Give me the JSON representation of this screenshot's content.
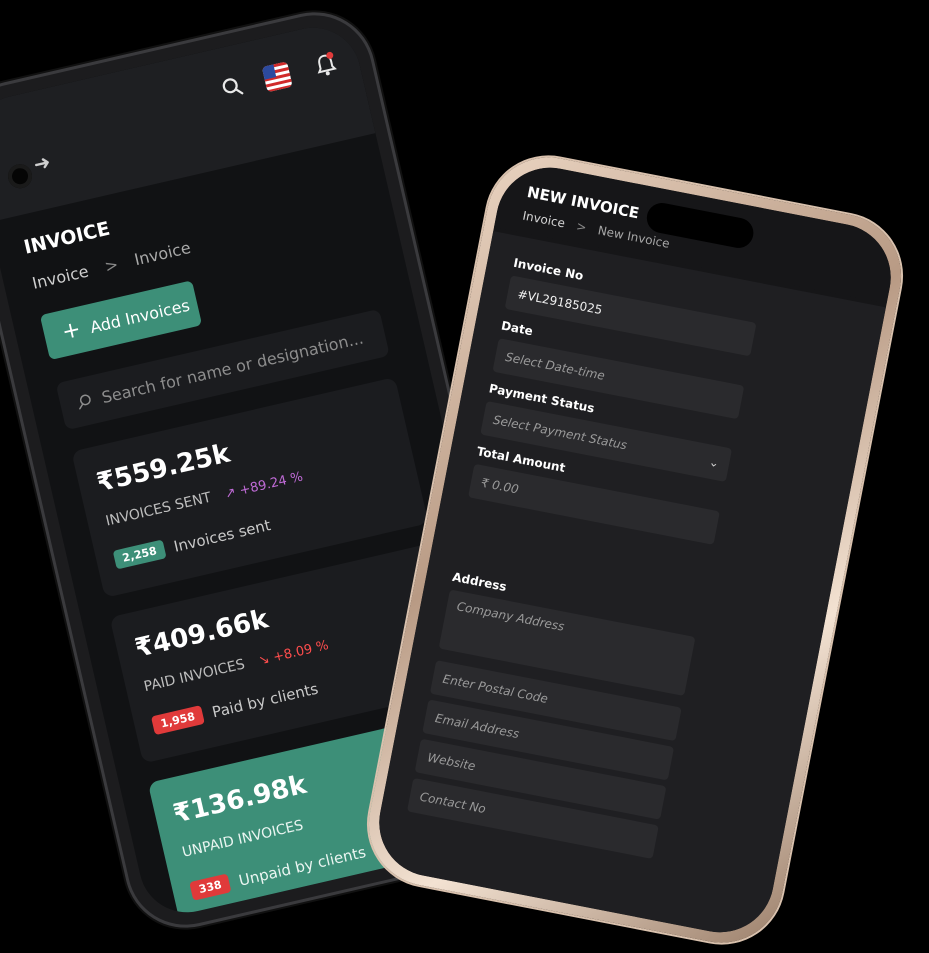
{
  "left_phone": {
    "title": "INVOICE",
    "breadcrumb": {
      "root": "Invoice",
      "separator": ">",
      "current": "Invoice"
    },
    "add_button": {
      "icon": "plus-icon",
      "label": "Add Invoices"
    },
    "search": {
      "placeholder": "Search for name or designation..."
    },
    "stats": [
      {
        "amount": "₹559.25k",
        "label": "INVOICES SENT",
        "change": "↗ +89.24 %",
        "trend": "up",
        "badge": "2,258",
        "badge_color": "#3d8f78",
        "footer": "Invoices sent"
      },
      {
        "amount": "₹409.66k",
        "label": "PAID INVOICES",
        "change": "↘ +8.09 %",
        "trend": "down",
        "badge": "1,958",
        "badge_color": "#e03a3a",
        "footer": "Paid by clients"
      },
      {
        "amount": "₹136.98k",
        "label": "UNPAID INVOICES",
        "badge": "338",
        "badge_color": "#e03a3a",
        "footer": "Unpaid by clients"
      }
    ],
    "accent": "#3d8f78"
  },
  "right_phone": {
    "title": "NEW INVOICE",
    "breadcrumb": {
      "root": "Invoice",
      "separator": ">",
      "current": "New Invoice"
    },
    "fields": {
      "invoice_no": {
        "label": "Invoice No",
        "value": "#VL29185025"
      },
      "date": {
        "label": "Date",
        "placeholder": "Select Date-time"
      },
      "payment_status": {
        "label": "Payment Status",
        "placeholder": "Select Payment Status"
      },
      "total_amount": {
        "label": "Total Amount",
        "placeholder": "₹ 0.00"
      },
      "address": {
        "label": "Address",
        "placeholder": "Company Address"
      },
      "postal_code": {
        "placeholder": "Enter Postal Code"
      },
      "email": {
        "placeholder": "Email Address"
      },
      "website": {
        "placeholder": "Website"
      },
      "contact": {
        "placeholder": "Contact No"
      }
    }
  }
}
